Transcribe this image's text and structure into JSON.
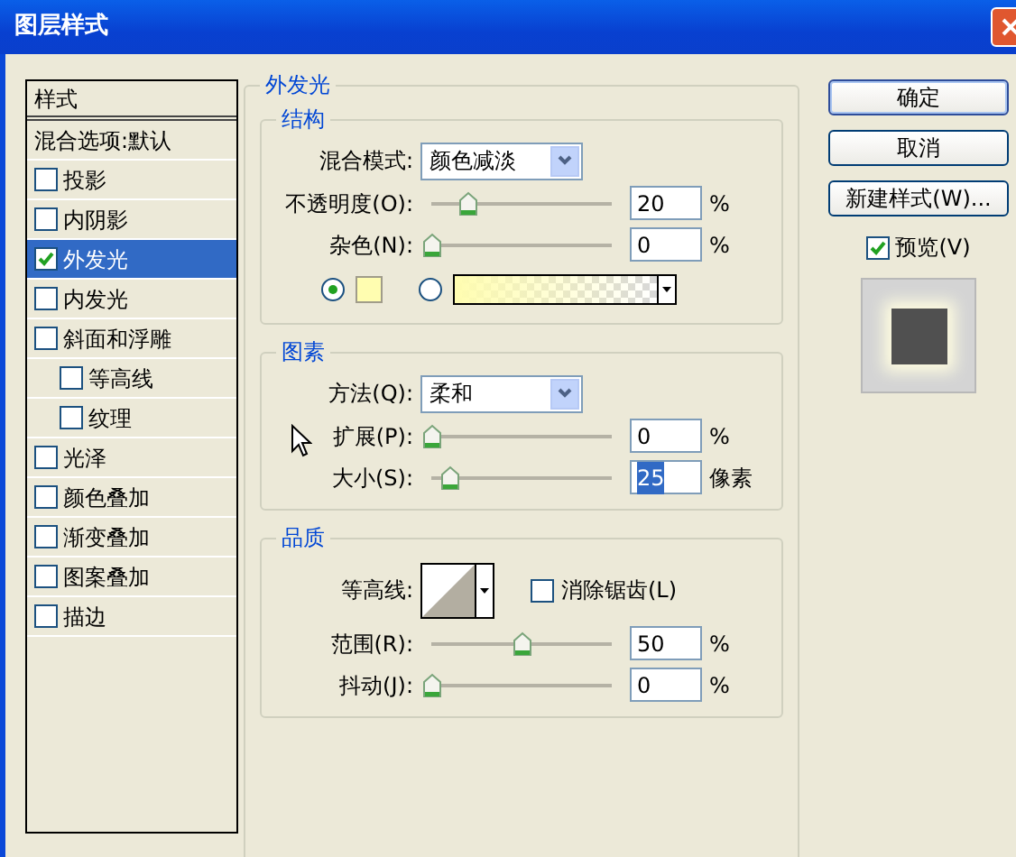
{
  "window": {
    "title": "图层样式"
  },
  "styles": {
    "header": "样式",
    "items": [
      {
        "label": "混合选项:默认",
        "kind": "plain",
        "selected": false
      },
      {
        "label": "投影",
        "kind": "check",
        "checked": false,
        "selected": false
      },
      {
        "label": "内阴影",
        "kind": "check",
        "checked": false,
        "selected": false
      },
      {
        "label": "外发光",
        "kind": "check",
        "checked": true,
        "selected": true
      },
      {
        "label": "内发光",
        "kind": "check",
        "checked": false,
        "selected": false
      },
      {
        "label": "斜面和浮雕",
        "kind": "check",
        "checked": false,
        "selected": false,
        "children": [
          {
            "label": "等高线",
            "kind": "check",
            "checked": false,
            "selected": false
          },
          {
            "label": "纹理",
            "kind": "check",
            "checked": false,
            "selected": false
          }
        ]
      },
      {
        "label": "光泽",
        "kind": "check",
        "checked": false,
        "selected": false
      },
      {
        "label": "颜色叠加",
        "kind": "check",
        "checked": false,
        "selected": false
      },
      {
        "label": "渐变叠加",
        "kind": "check",
        "checked": false,
        "selected": false
      },
      {
        "label": "图案叠加",
        "kind": "check",
        "checked": false,
        "selected": false
      },
      {
        "label": "描边",
        "kind": "check",
        "checked": false,
        "selected": false
      }
    ]
  },
  "panel": {
    "title": "外发光",
    "sections": [
      {
        "title": "结构",
        "rows": [
          {
            "kind": "select",
            "label": "混合模式:",
            "value": "颜色减淡"
          },
          {
            "kind": "slider",
            "label": "不透明度(O):",
            "level": 0.2,
            "value": "20",
            "unit": "%"
          },
          {
            "kind": "slider",
            "label": "杂色(N):",
            "level": 0,
            "value": "0",
            "unit": "%"
          },
          {
            "kind": "color",
            "solid_selected": true,
            "gradient_selected": false
          }
        ]
      },
      {
        "title": "图素",
        "rows": [
          {
            "kind": "select",
            "label": "方法(Q):",
            "value": "柔和"
          },
          {
            "kind": "slider",
            "label": "扩展(P):",
            "level": 0,
            "value": "0",
            "unit": "%"
          },
          {
            "kind": "slider",
            "label": "大小(S):",
            "level": 0.1,
            "value": "25",
            "unit": "像素",
            "highlighted": true
          }
        ]
      },
      {
        "title": "品质",
        "rows": [
          {
            "kind": "contour",
            "label": "等高线:",
            "checkbox_label": "消除锯齿(L)",
            "checked": false
          },
          {
            "kind": "slider",
            "label": "范围(R):",
            "level": 0.5,
            "value": "50",
            "unit": "%"
          },
          {
            "kind": "slider",
            "label": "抖动(J):",
            "level": 0,
            "value": "0",
            "unit": "%"
          }
        ]
      }
    ]
  },
  "buttons": [
    "确定",
    "取消",
    "新建样式(W)..."
  ],
  "preview": {
    "label": "预览(V)",
    "checked": true
  }
}
